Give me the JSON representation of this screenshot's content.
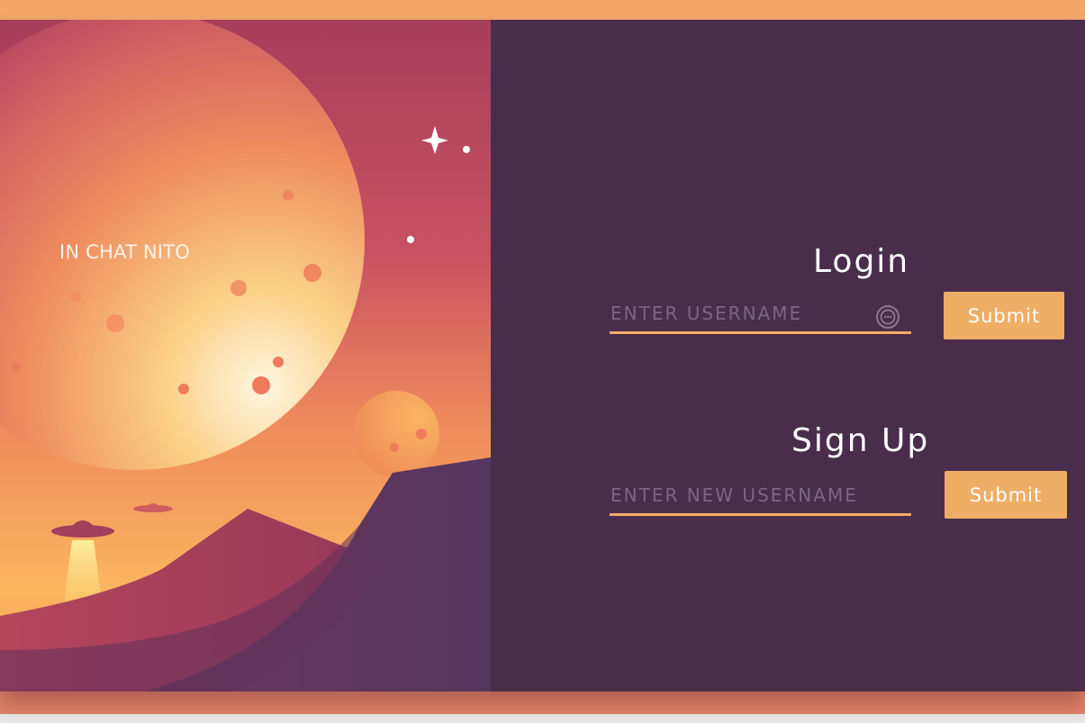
{
  "brand": {
    "name": "IN CHAT NITO"
  },
  "login": {
    "title": "Login",
    "username_placeholder": "ENTER USERNAME",
    "username_value": "",
    "submit_label": "Submit",
    "field_icon": "password-manager-icon"
  },
  "signup": {
    "title": "Sign Up",
    "username_placeholder": "ENTER NEW USERNAME",
    "username_value": "",
    "submit_label": "Submit"
  },
  "colors": {
    "panel_background": "#4a2d4b",
    "accent": "#efae66",
    "text": "#ffffff",
    "placeholder": "#7c6684",
    "page_background": "#f3a86a"
  }
}
